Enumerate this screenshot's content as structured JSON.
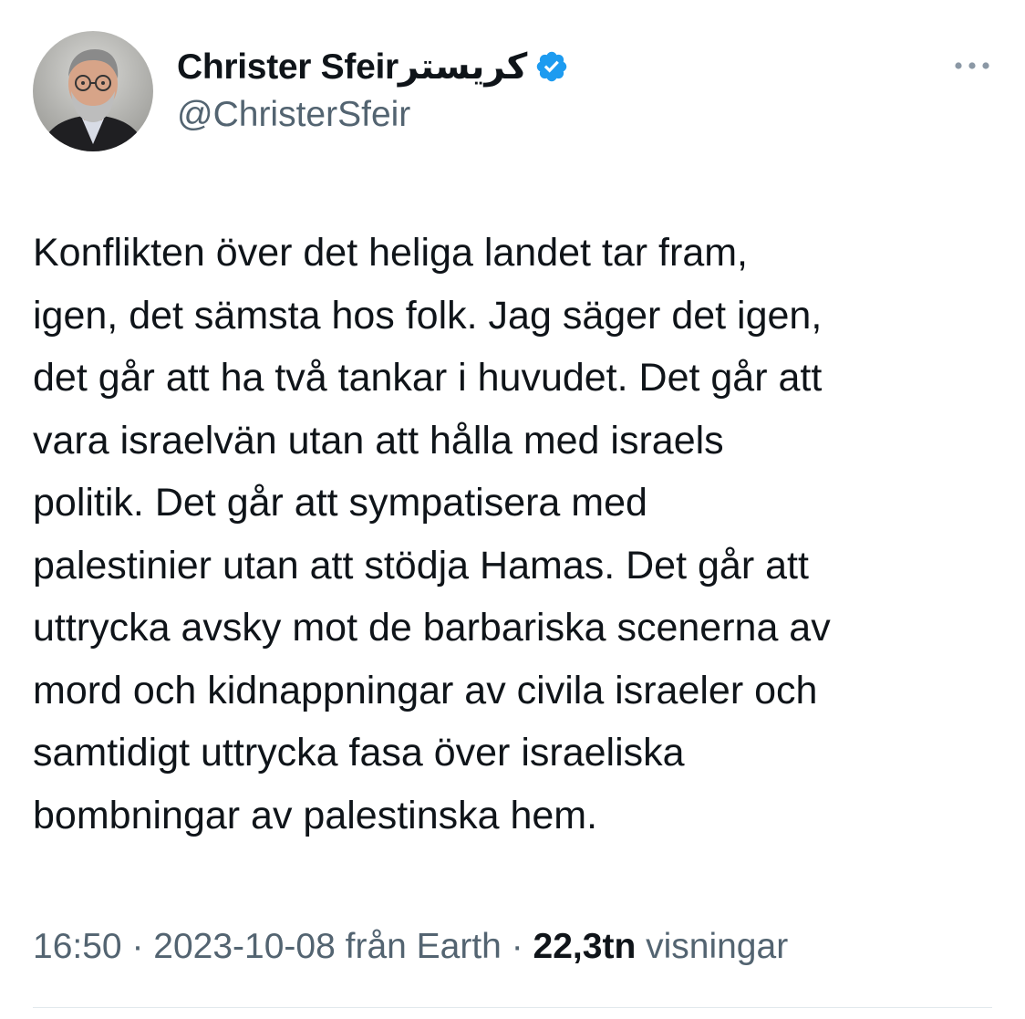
{
  "author": {
    "display_name": "Christer Sfeirكريستر",
    "handle": "@ChristerSfeir",
    "verified_badge_icon": "verified-badge-icon",
    "verified_color": "#1d9bf0"
  },
  "more_icon": "more-options-icon",
  "tweet": {
    "lines": [
      "Konflikten över det heliga landet tar fram,",
      "igen, det sämsta hos folk. Jag säger det igen,",
      "det går att ha två tankar i huvudet. Det går att",
      "vara israelvän utan att hålla med israels",
      "politik. Det går att sympatisera med",
      "palestinier utan att stödja Hamas. Det går att",
      "uttrycka avsky mot de barbariska scenerna av",
      "mord och kidnappningar av civila israeler och",
      "samtidigt uttrycka fasa över israeliska",
      "bombningar av palestinska hem."
    ]
  },
  "meta": {
    "time": "16:50",
    "separator": " · ",
    "date": "2023-10-08",
    "source": " från Earth",
    "views_count": "22,3tn",
    "views_label": " visningar"
  }
}
